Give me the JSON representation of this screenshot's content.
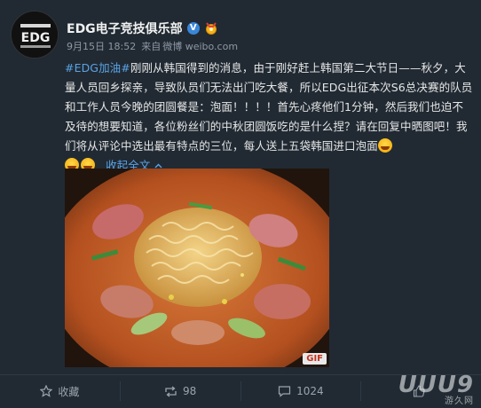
{
  "post": {
    "author": "EDG电子竞技俱乐部",
    "avatar_text": "EDG",
    "date": "9月15日 18:52",
    "source_prefix": "来自",
    "source": "微博 weibo.com",
    "hashtag": "#EDG加油#",
    "text_main": "刚刚从韩国得到的消息，由于刚好赶上韩国第二大节日——秋夕，大量人员回乡探亲，导致队员们无法出门吃大餐，所以EDG出征本次S6总决赛的队员和工作人员今晚的团圆餐是：泡面！！！！首先心疼他们1分钟，然后我们也迫不及待的想要知道，各位粉丝们的中秋团圆饭吃的是什么捏？请在回复中晒图吧！我们将从评论中选出最有特点的三位，每人送上五袋韩国进口泡面",
    "collapse_label": "收起全文",
    "gif_label": "GIF"
  },
  "actions": {
    "favorite_label": "收藏",
    "repost_count": "98",
    "comment_count": "1024",
    "like_count": ""
  },
  "watermark": {
    "text": "UUU9",
    "sub": "游久网"
  },
  "colors": {
    "background": "#212a33",
    "link": "#5aa3e6",
    "verified": "#3a86d8"
  },
  "icons": [
    "verified-icon",
    "medal-icon",
    "chevron-down-icon",
    "star-icon",
    "repost-icon",
    "comment-icon",
    "like-icon"
  ]
}
